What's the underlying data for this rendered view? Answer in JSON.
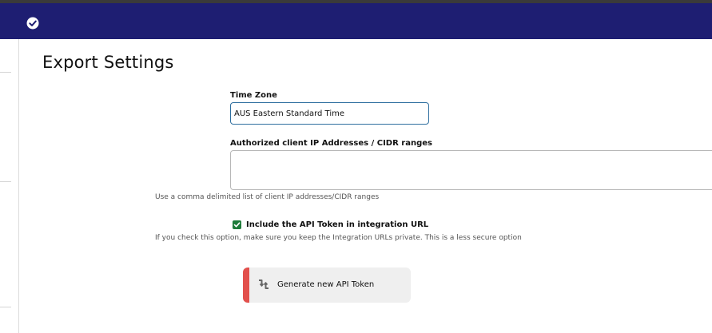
{
  "header": {
    "icon": "check-circle-icon",
    "bg_color": "#1e1e72"
  },
  "page": {
    "title": "Export Settings"
  },
  "timezone": {
    "label": "Time Zone",
    "value": "AUS Eastern Standard Time"
  },
  "ip_ranges": {
    "label": "Authorized client IP Addresses / CIDR ranges",
    "value": "",
    "help": "Use a comma delimited list of client IP addresses/CIDR ranges"
  },
  "api_token_option": {
    "label": "Include the API Token in integration URL",
    "checked": true,
    "help": "If you check this option, make sure you keep the Integration URLs private. This is a less secure option"
  },
  "generate_button": {
    "label": "Generate new API Token",
    "icon": "refresh-icon",
    "accent_color": "#e2504c"
  }
}
